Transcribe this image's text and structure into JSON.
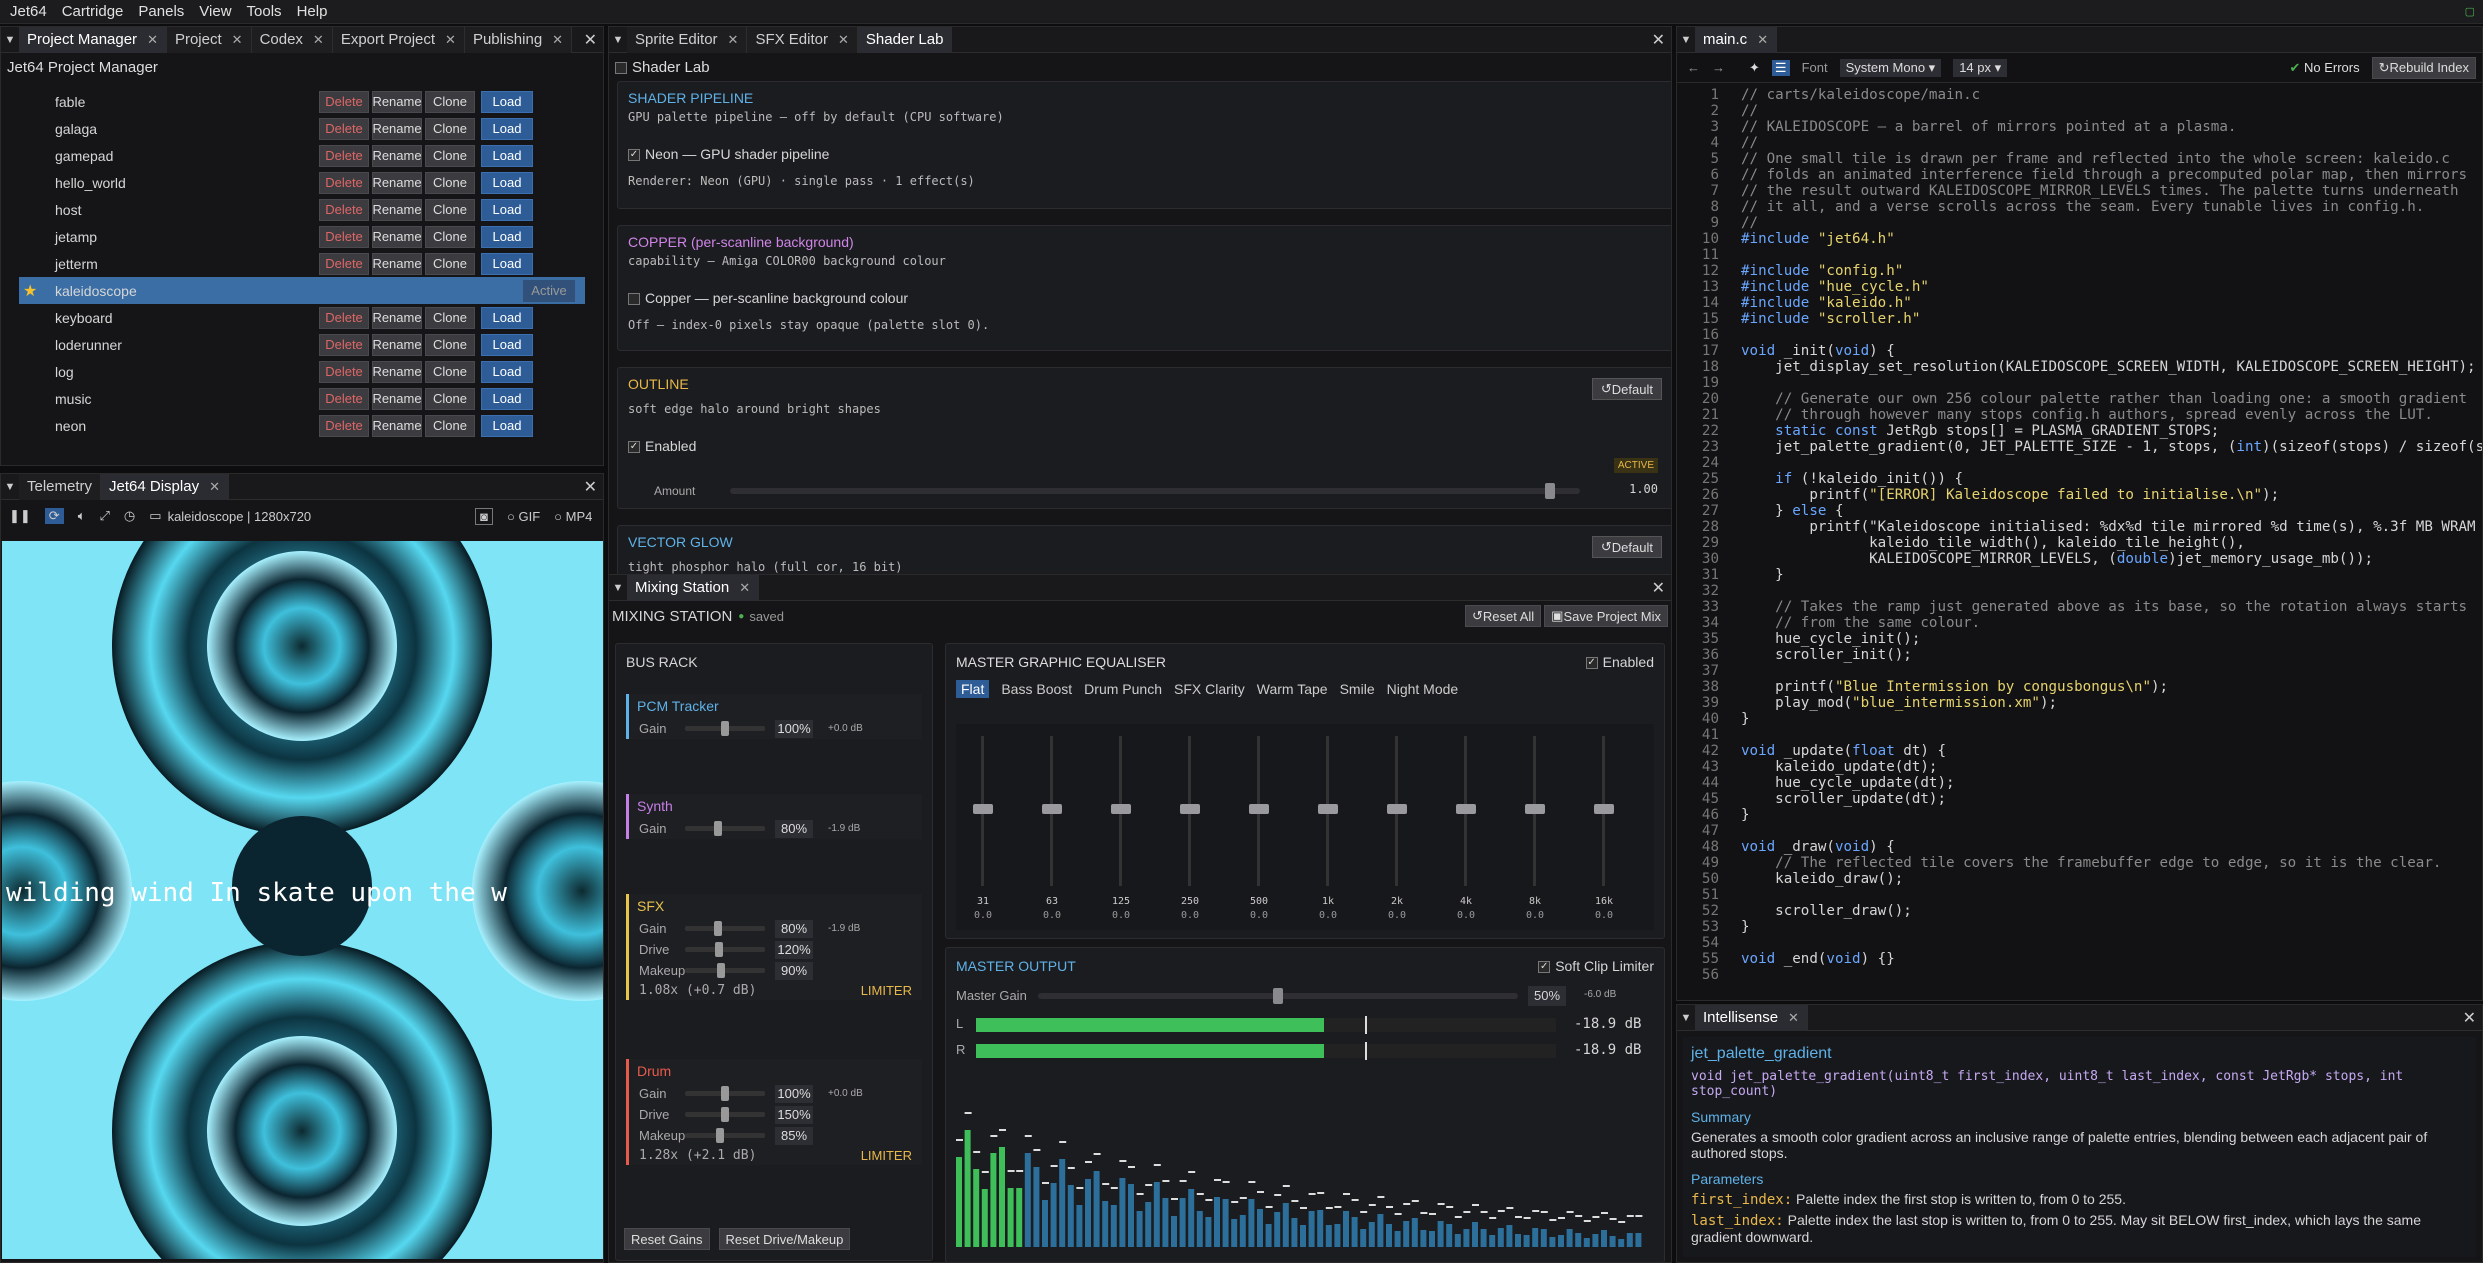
{
  "menu": [
    "Jet64",
    "Cartridge",
    "Panels",
    "View",
    "Tools",
    "Help"
  ],
  "left_tabs": [
    "Project Manager",
    "Project",
    "Codex",
    "Export Project",
    "Publishing"
  ],
  "pm": {
    "title": "Jet64 Project Manager",
    "del": "Delete",
    "ren": "Rename",
    "clo": "Clone",
    "load": "Load",
    "active": "Active",
    "projects": [
      "fable",
      "galaga",
      "gamepad",
      "hello_world",
      "host",
      "jetamp",
      "jetterm",
      "kaleidoscope",
      "keyboard",
      "loderunner",
      "log",
      "music",
      "neon"
    ]
  },
  "bottom_left_tabs": [
    "Telemetry",
    "Jet64 Display"
  ],
  "display": {
    "info": "kaleidoscope | 1280x720",
    "gif": "GIF",
    "mp4": "MP4",
    "scroll_text": "wilding wind In skate upon the w"
  },
  "mid_tabs": [
    "Sprite Editor",
    "SFX Editor",
    "Shader Lab"
  ],
  "shader": {
    "title": "Shader Lab",
    "pipeline": {
      "t": "SHADER PIPELINE",
      "s": "GPU palette pipeline — off by default (CPU software)",
      "cb": "Neon — GPU shader pipeline",
      "info": "Renderer: Neon (GPU) · single pass · 1 effect(s)"
    },
    "copper": {
      "t": "COPPER",
      "t2": "(per-scanline background)",
      "s": "capability — Amiga COLOR00 background colour",
      "cb": "Copper — per-scanline background colour",
      "info": "Off — index-0 pixels stay opaque (palette slot 0)."
    },
    "outline": {
      "t": "OUTLINE",
      "s": "soft edge halo around bright shapes",
      "cb": "Enabled",
      "badge": "ACTIVE",
      "amount": "Amount",
      "val": "1.00",
      "def": "Default",
      "level": 0.97
    },
    "glow": {
      "t": "VECTOR GLOW",
      "s": "tight phosphor halo (full cor, 16 bit)",
      "def": "Default"
    }
  },
  "mix": {
    "tab": "Mixing Station",
    "title": "MIXING STATION",
    "saved": "saved",
    "reset": "Reset All",
    "save": "Save Project Mix",
    "busrack": "BUS RACK",
    "buses": [
      {
        "name": "PCM Tracker",
        "color": "#5fb2e8",
        "rows": [
          {
            "l": "Gain",
            "v": "100%",
            "db": "+0.0 dB",
            "p": 0.5
          }
        ]
      },
      {
        "name": "Synth",
        "color": "#c77ee6",
        "rows": [
          {
            "l": "Gain",
            "v": "80%",
            "db": "-1.9 dB",
            "p": 0.4
          }
        ]
      },
      {
        "name": "SFX",
        "color": "#e8c44a",
        "rows": [
          {
            "l": "Gain",
            "v": "80%",
            "db": "-1.9 dB",
            "p": 0.4
          },
          {
            "l": "Drive",
            "v": "120%",
            "db": "",
            "p": 0.42
          },
          {
            "l": "Makeup",
            "v": "90%",
            "db": "",
            "p": 0.45
          }
        ],
        "extra": "1.08x (+0.7 dB)",
        "lim": "LIMITER"
      },
      {
        "name": "Drum",
        "color": "#e85a4a",
        "rows": [
          {
            "l": "Gain",
            "v": "100%",
            "db": "+0.0 dB",
            "p": 0.5
          },
          {
            "l": "Drive",
            "v": "150%",
            "db": "",
            "p": 0.5
          },
          {
            "l": "Makeup",
            "v": "85%",
            "db": "",
            "p": 0.43
          }
        ],
        "extra": "1.28x (+2.1 dB)",
        "lim": "LIMITER"
      }
    ],
    "reset_gains": "Reset Gains",
    "reset_drive": "Reset Drive/Makeup",
    "eq": {
      "title": "MASTER GRAPHIC EQUALISER",
      "enabled": "Enabled",
      "presets": [
        "Flat",
        "Bass Boost",
        "Drum Punch",
        "SFX Clarity",
        "Warm Tape",
        "Smile",
        "Night Mode"
      ],
      "bands": [
        "31",
        "63",
        "125",
        "250",
        "500",
        "1k",
        "2k",
        "4k",
        "8k",
        "16k"
      ],
      "gain": "0.0"
    },
    "out": {
      "title": "MASTER OUTPUT",
      "soft": "Soft Clip Limiter",
      "gain_label": "Master Gain",
      "gain": "50%",
      "gain_db": "-6.0 dB",
      "gain_level": 0.5,
      "L": "L",
      "R": "R",
      "Ldb": "-18.9 dB",
      "Rdb": "-18.9 dB",
      "level": 0.6
    }
  },
  "editor": {
    "tab": "main.c",
    "font_label": "Font",
    "font": "System Mono",
    "size": "14 px",
    "noerr": "No Errors",
    "rebuild": "Rebuild Index"
  },
  "code": [
    "// carts/kaleidoscope/main.c",
    "//",
    "// KALEIDOSCOPE — a barrel of mirrors pointed at a plasma.",
    "//",
    "// One small tile is drawn per frame and reflected into the whole screen: kaleido.c",
    "// folds an animated interference field through a precomputed polar map, then mirrors",
    "// the result outward KALEIDOSCOPE_MIRROR_LEVELS times. The palette turns underneath",
    "// it all, and a verse scrolls across the seam. Every tunable lives in config.h.",
    "//",
    "#include \"jet64.h\"",
    "",
    "#include \"config.h\"",
    "#include \"hue_cycle.h\"",
    "#include \"kaleido.h\"",
    "#include \"scroller.h\"",
    "",
    "void _init(void) {",
    "    jet_display_set_resolution(KALEIDOSCOPE_SCREEN_WIDTH, KALEIDOSCOPE_SCREEN_HEIGHT);",
    "",
    "    // Generate our own 256 colour palette rather than loading one: a smooth gradient",
    "    // through however many stops config.h authors, spread evenly across the LUT.",
    "    static const JetRgb stops[] = PLASMA_GRADIENT_STOPS;",
    "    jet_palette_gradient(0, JET_PALETTE_SIZE - 1, stops, (int)(sizeof(stops) / sizeof(s",
    "",
    "    if (!kaleido_init()) {",
    "        printf(\"[ERROR] Kaleidoscope failed to initialise.\\n\");",
    "    } else {",
    "        printf(\"Kaleidoscope initialised: %dx%d tile mirrored %d time(s), %.3f MB WRAM",
    "               kaleido_tile_width(), kaleido_tile_height(),",
    "               KALEIDOSCOPE_MIRROR_LEVELS, (double)jet_memory_usage_mb());",
    "    }",
    "",
    "    // Takes the ramp just generated above as its base, so the rotation always starts",
    "    // from the same colour.",
    "    hue_cycle_init();",
    "    scroller_init();",
    "",
    "    printf(\"Blue Intermission by congusbongus\\n\");",
    "    play_mod(\"blue_intermission.xm\");",
    "}",
    "",
    "void _update(float dt) {",
    "    kaleido_update(dt);",
    "    hue_cycle_update(dt);",
    "    scroller_update(dt);",
    "}",
    "",
    "void _draw(void) {",
    "    // The reflected tile covers the framebuffer edge to edge, so it is the clear.",
    "    kaleido_draw();",
    "",
    "    scroller_draw();",
    "}",
    "",
    "void _end(void) {}",
    ""
  ],
  "intellisense": {
    "tab": "Intellisense",
    "fn": "jet_palette_gradient",
    "sig": "void jet_palette_gradient(uint8_t first_index, uint8_t last_index, const JetRgb* stops, int stop_count)",
    "summary_h": "Summary",
    "summary": "Generates a smooth color gradient across an inclusive range of palette entries, blending between each adjacent pair of authored stops.",
    "params_h": "Parameters",
    "p1n": "first_index:",
    "p1": "Palette index the first stop is written to, from 0 to 255.",
    "p2n": "last_index:",
    "p2": "Palette index the last stop is written to, from 0 to 255. May sit BELOW first_index, which lays the same gradient downward."
  }
}
